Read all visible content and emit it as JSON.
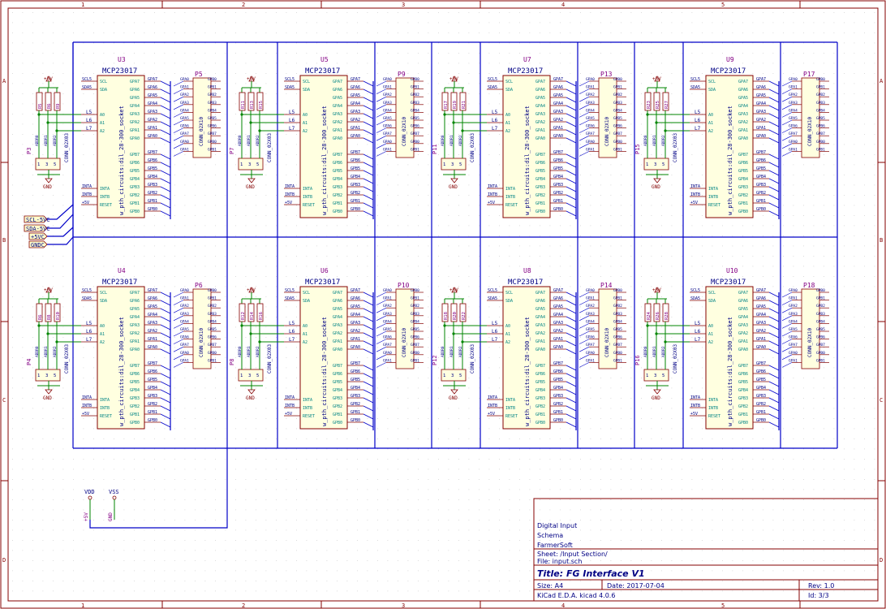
{
  "colors": {
    "wire": "#008400",
    "bus": "#0000c8",
    "component": "#840000",
    "text": "#000084",
    "pin_text": "#008484",
    "reference": "#840084",
    "power": "#840000",
    "sheet_border": "#840000",
    "grid_dot": "#c8c8c8",
    "label_bg": "#ffffcc"
  },
  "frame": {
    "col_marks": [
      "1",
      "2",
      "3",
      "4",
      "5"
    ],
    "row_marks": [
      "A",
      "B",
      "C",
      "D"
    ]
  },
  "chip": {
    "value": "MCP23017",
    "footprint": "w_pth_circuits:dil_28-300_socket",
    "left_pins_top": [
      "SCL",
      "SDA"
    ],
    "left_pins_addr": [
      "A0",
      "A1",
      "A2"
    ],
    "left_pins_bottom": [
      "INTA",
      "INTB",
      "RESET"
    ],
    "right_pins_a": [
      "GPA7",
      "GPA6",
      "GPA5",
      "GPA4",
      "GPA3",
      "GPA2",
      "GPA1",
      "GPA0"
    ],
    "right_pins_b": [
      "GPB7",
      "GPB6",
      "GPB5",
      "GPB4",
      "GPB3",
      "GPB2",
      "GPB1",
      "GPB0"
    ],
    "addr_labels": [
      "L5",
      "L6",
      "L7"
    ],
    "jumper_value": "CONN_02X03",
    "header_value": "CONN_02X10",
    "power_label": "+5V",
    "ground_label": "GND"
  },
  "units": [
    {
      "ref": "U3",
      "header": "P5",
      "addr_header": "P3",
      "resistors": [
        "R5",
        "R6",
        "R9"
      ]
    },
    {
      "ref": "U5",
      "header": "P9",
      "addr_header": "P7",
      "resistors": [
        "R11",
        "R13",
        "R15"
      ]
    },
    {
      "ref": "U7",
      "header": "P13",
      "addr_header": "P11",
      "resistors": [
        "R17",
        "R19",
        "R21"
      ]
    },
    {
      "ref": "U9",
      "header": "P17",
      "addr_header": "P15",
      "resistors": [
        "R23",
        "R25",
        "R27"
      ]
    },
    {
      "ref": "U4",
      "header": "P6",
      "addr_header": "P4",
      "resistors": [
        "R6",
        "R8",
        "R10"
      ]
    },
    {
      "ref": "U6",
      "header": "P10",
      "addr_header": "P8",
      "resistors": [
        "R12",
        "R14",
        "R16"
      ]
    },
    {
      "ref": "U8",
      "header": "P14",
      "addr_header": "P12",
      "resistors": [
        "R18",
        "R20",
        "R22"
      ]
    },
    {
      "ref": "U10",
      "header": "P18",
      "addr_header": "P16",
      "resistors": [
        "R24",
        "R26",
        "R28"
      ]
    }
  ],
  "hier_labels": [
    "SCL-5VC",
    "SDA-5VC",
    "+5VC",
    "GNDC"
  ],
  "power_symbols": {
    "vdd": "VDD",
    "vss": "VSS",
    "vdd_net": "+5V",
    "vss_net": "GND"
  },
  "title_block": {
    "comments": [
      "Digital Input",
      "Schema",
      "FarmerSoft"
    ],
    "sheet": "Sheet: /Input Section/",
    "file": "File: input.sch",
    "title": "Title: FG Interface V1",
    "size": "Size: A4",
    "date": "Date: 2017-07-04",
    "rev": "Rev: 1.0",
    "tool": "KiCad E.D.A.  kicad 4.0.6",
    "id": "Id: 3/3"
  }
}
